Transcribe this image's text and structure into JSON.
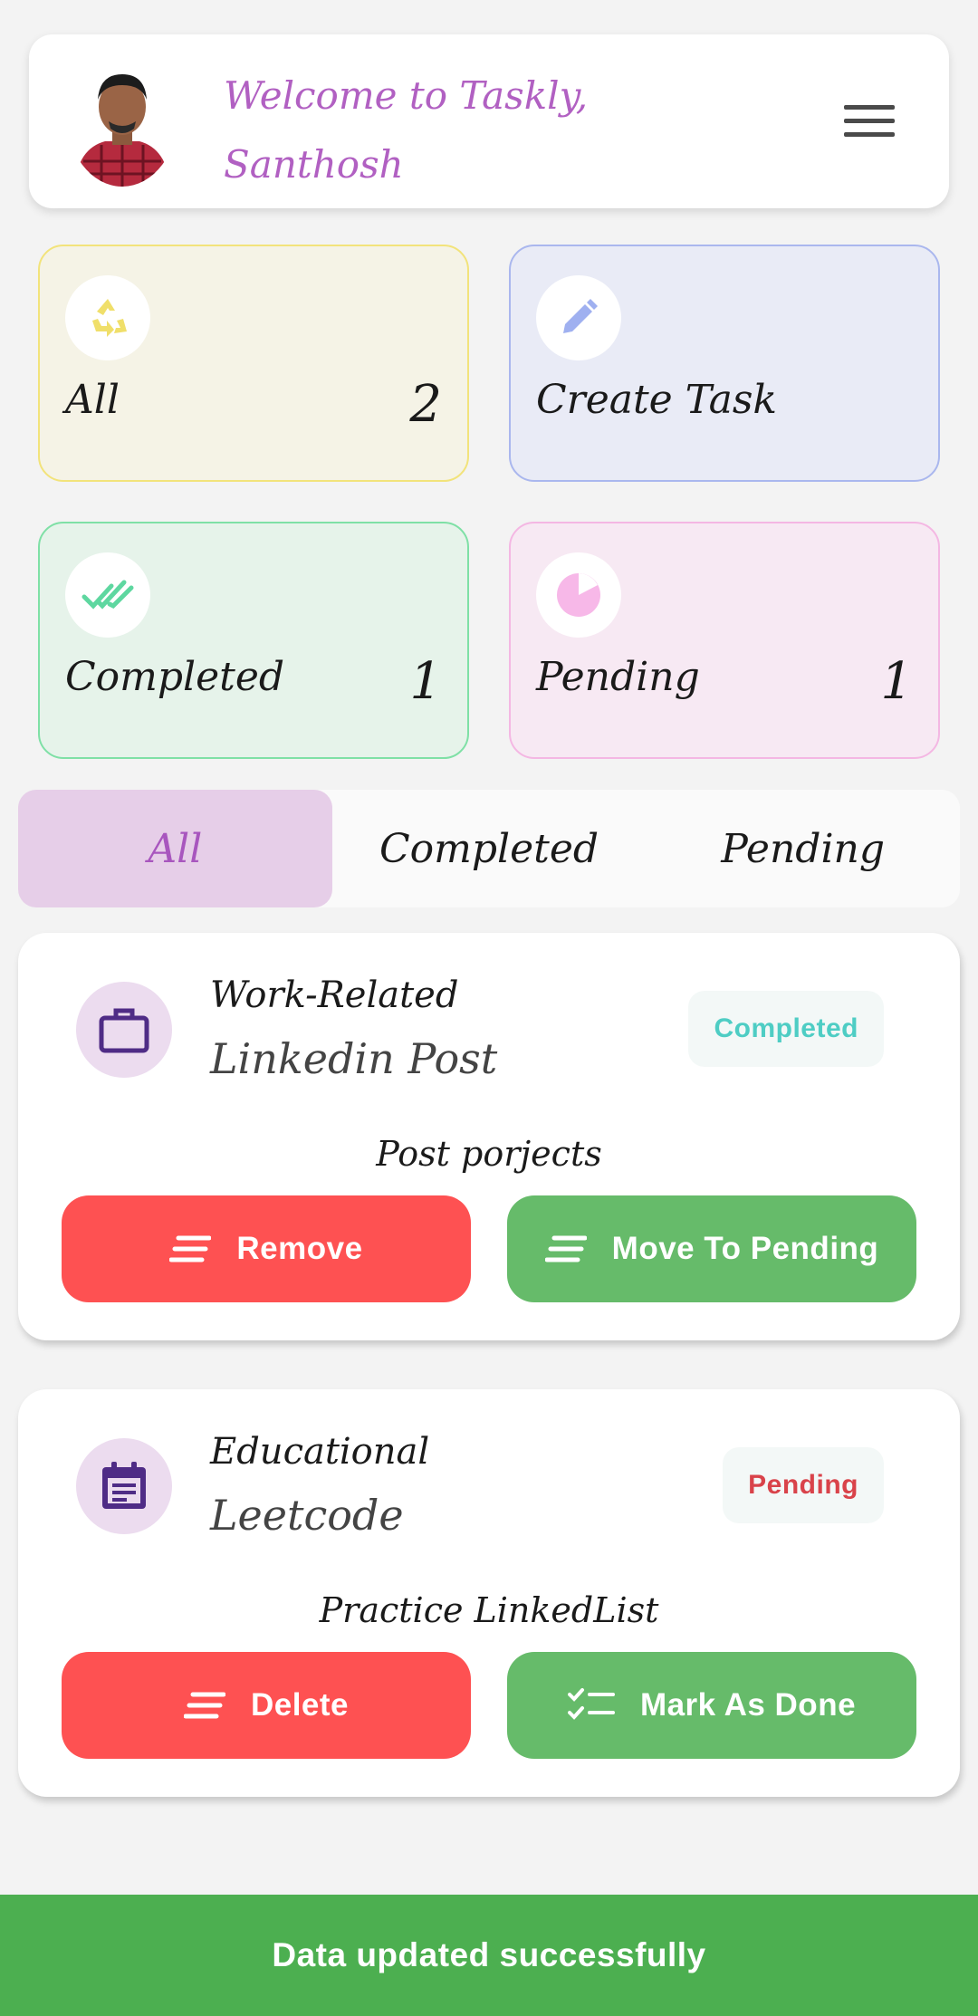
{
  "header": {
    "welcome_line1": "Welcome to Taskly,",
    "welcome_line2": "Santhosh"
  },
  "stats": {
    "all": {
      "label": "All",
      "count": "2"
    },
    "create": {
      "label": "Create Task"
    },
    "completed": {
      "label": "Completed",
      "count": "1"
    },
    "pending": {
      "label": "Pending",
      "count": "1"
    }
  },
  "tabs": [
    {
      "label": "All",
      "active": true
    },
    {
      "label": "Completed",
      "active": false
    },
    {
      "label": "Pending",
      "active": false
    }
  ],
  "tasks": [
    {
      "category": "Work-Related",
      "title": "Linkedin Post",
      "status": "Completed",
      "status_color": "#4ecdc4",
      "description": "Post porjects",
      "btn_left": "Remove",
      "btn_right": "Move To Pending"
    },
    {
      "category": "Educational",
      "title": "Leetcode",
      "status": "Pending",
      "status_color": "#d9434a",
      "description": "Practice LinkedList",
      "btn_left": "Delete",
      "btn_right": "Mark As Done"
    }
  ],
  "snackbar": {
    "message": "Data updated successfully"
  },
  "colors": {
    "accent": "#b160c2",
    "remove": "#fe5152",
    "done": "#66bb6a",
    "snackbar": "#4caf50"
  }
}
